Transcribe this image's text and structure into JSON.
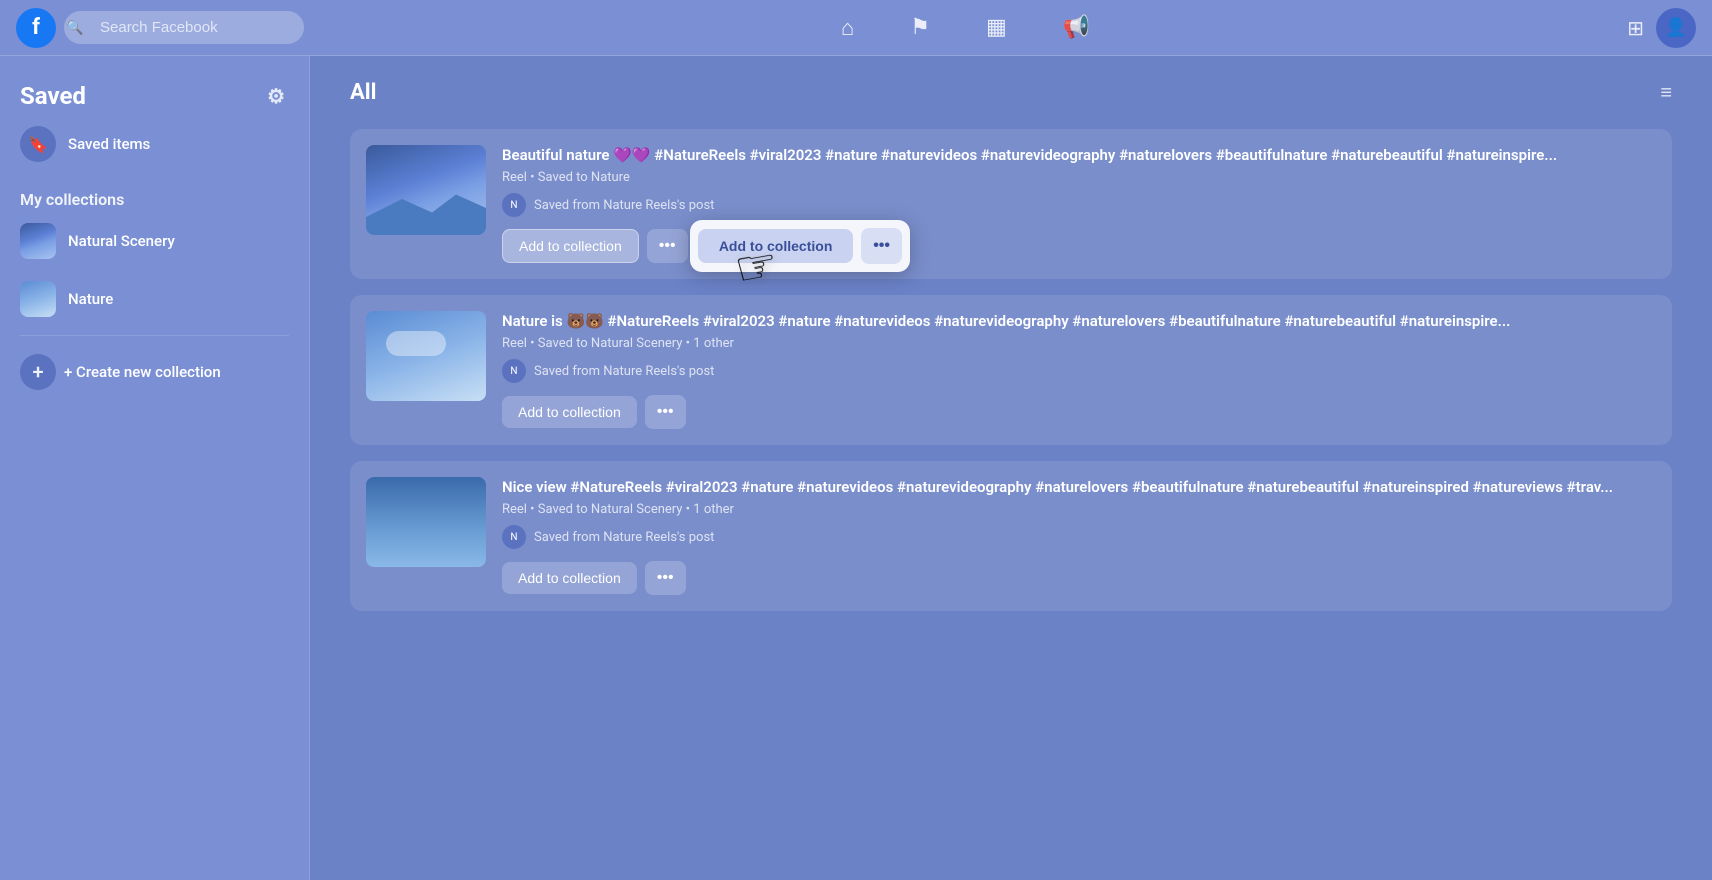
{
  "app": {
    "name": "Facebook",
    "logo": "f"
  },
  "topnav": {
    "search_placeholder": "Search Facebook",
    "grid_icon": "⊞",
    "home_icon": "⌂",
    "flag_icon": "⚑",
    "chart_icon": "▦",
    "megaphone_icon": "📢"
  },
  "sidebar": {
    "title": "Saved",
    "gear_icon": "⚙",
    "saved_items_label": "Saved items",
    "my_collections_label": "My collections",
    "collections": [
      {
        "name": "Natural Scenery",
        "icon": "🏔"
      },
      {
        "name": "Nature",
        "icon": "🌿"
      }
    ],
    "create_label": "+ Create new collection"
  },
  "content": {
    "section_title": "All",
    "filter_icon": "≡",
    "items": [
      {
        "id": 1,
        "title": "Beautiful nature 💜💜 #NatureReels #viral2023 #nature #naturevideos #naturevideography #naturelovers #beautifulnature #naturebeautiful #natureinspire...",
        "meta": "Reel • Saved to Nature",
        "saved_from": "Saved from Nature Reels's post",
        "add_btn": "Add to collection",
        "more_btn": "•••"
      },
      {
        "id": 2,
        "title": "Nature is 🐻🐻 #NatureReels #viral2023 #nature #naturevideos #naturevideography #naturelovers #beautifulnature #naturebeautiful #natureinspire...",
        "meta": "Reel • Saved to Natural Scenery • 1 other",
        "saved_from": "Saved from Nature Reels's post",
        "add_btn": "Add to collection",
        "more_btn": "•••"
      },
      {
        "id": 3,
        "title": "Nice view #NatureReels #viral2023 #nature #naturevideos #naturevideography #naturelovers #beautifulnature #naturebeautiful #natureinspired #natureviews #trav...",
        "meta": "Reel • Saved to Natural Scenery • 1 other",
        "saved_from": "Saved from Nature Reels's post",
        "add_btn": "Add to collection",
        "more_btn": "•••"
      }
    ]
  },
  "popup": {
    "add_label": "Add to collection",
    "more_label": "•••"
  }
}
